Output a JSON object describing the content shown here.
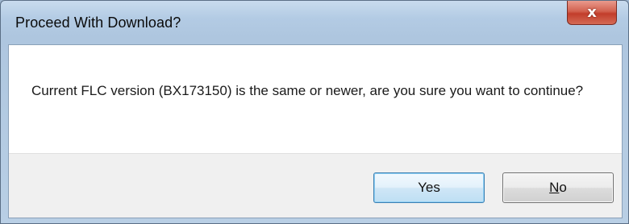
{
  "window": {
    "title": "Proceed With Download?",
    "close_icon": "close-icon",
    "close_glyph": "x"
  },
  "message": {
    "text": "Current FLC version (BX173150) is the same or newer, are you sure you want to continue?"
  },
  "buttons": {
    "yes_label": "Yes",
    "no_mnemonic": "N",
    "no_rest": "o"
  },
  "colors": {
    "close_button": "#c23d2b",
    "default_button_border": "#3c7fb1"
  }
}
